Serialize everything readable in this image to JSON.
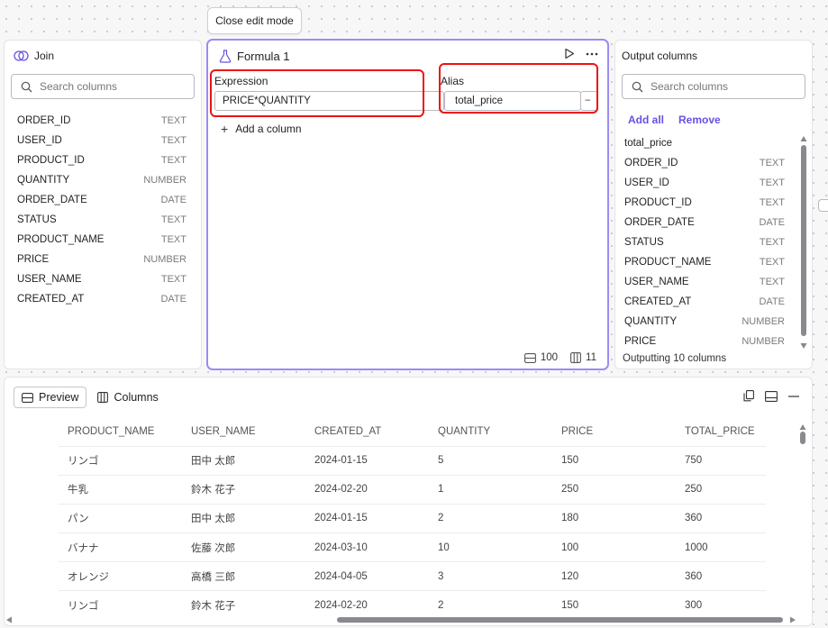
{
  "toolbar": {
    "close_edit_label": "Close edit mode"
  },
  "join_panel": {
    "title": "Join",
    "search_placeholder": "Search columns",
    "columns": [
      {
        "name": "ORDER_ID",
        "type": "TEXT"
      },
      {
        "name": "USER_ID",
        "type": "TEXT"
      },
      {
        "name": "PRODUCT_ID",
        "type": "TEXT"
      },
      {
        "name": "QUANTITY",
        "type": "NUMBER"
      },
      {
        "name": "ORDER_DATE",
        "type": "DATE"
      },
      {
        "name": "STATUS",
        "type": "TEXT"
      },
      {
        "name": "PRODUCT_NAME",
        "type": "TEXT"
      },
      {
        "name": "PRICE",
        "type": "NUMBER"
      },
      {
        "name": "USER_NAME",
        "type": "TEXT"
      },
      {
        "name": "CREATED_AT",
        "type": "DATE"
      }
    ]
  },
  "formula_panel": {
    "title": "Formula 1",
    "expression_label": "Expression",
    "expression_value": "PRICE*QUANTITY",
    "alias_label": "Alias",
    "alias_value": "total_price",
    "remove_symbol": "−",
    "add_column_label": "Add a column",
    "add_column_symbol": "+",
    "row_count": "100",
    "column_count": "11"
  },
  "output_panel": {
    "title": "Output columns",
    "search_placeholder": "Search columns",
    "add_all_label": "Add all",
    "remove_label": "Remove",
    "columns": [
      {
        "name": "total_price",
        "type": ""
      },
      {
        "name": "ORDER_ID",
        "type": "TEXT"
      },
      {
        "name": "USER_ID",
        "type": "TEXT"
      },
      {
        "name": "PRODUCT_ID",
        "type": "TEXT"
      },
      {
        "name": "ORDER_DATE",
        "type": "DATE"
      },
      {
        "name": "STATUS",
        "type": "TEXT"
      },
      {
        "name": "PRODUCT_NAME",
        "type": "TEXT"
      },
      {
        "name": "USER_NAME",
        "type": "TEXT"
      },
      {
        "name": "CREATED_AT",
        "type": "DATE"
      },
      {
        "name": "QUANTITY",
        "type": "NUMBER"
      },
      {
        "name": "PRICE",
        "type": "NUMBER"
      }
    ],
    "status": "Outputting 10 columns"
  },
  "preview": {
    "tabs": [
      {
        "label": "Preview",
        "active": true
      },
      {
        "label": "Columns",
        "active": false
      }
    ],
    "headers": [
      "PRODUCT_NAME",
      "USER_NAME",
      "CREATED_AT",
      "QUANTITY",
      "PRICE",
      "TOTAL_PRICE"
    ],
    "rows": [
      [
        "リンゴ",
        "田中 太郎",
        "2024-01-15",
        "5",
        "150",
        "750"
      ],
      [
        "牛乳",
        "鈴木 花子",
        "2024-02-20",
        "1",
        "250",
        "250"
      ],
      [
        "パン",
        "田中 太郎",
        "2024-01-15",
        "2",
        "180",
        "360"
      ],
      [
        "バナナ",
        "佐藤 次郎",
        "2024-03-10",
        "10",
        "100",
        "1000"
      ],
      [
        "オレンジ",
        "高橋 三郎",
        "2024-04-05",
        "3",
        "120",
        "360"
      ],
      [
        "リンゴ",
        "鈴木 花子",
        "2024-02-20",
        "2",
        "150",
        "300"
      ]
    ]
  },
  "colors": {
    "accent": "#6b4fe0",
    "formula_border": "#9b8cf2",
    "highlight": "#e11111"
  }
}
